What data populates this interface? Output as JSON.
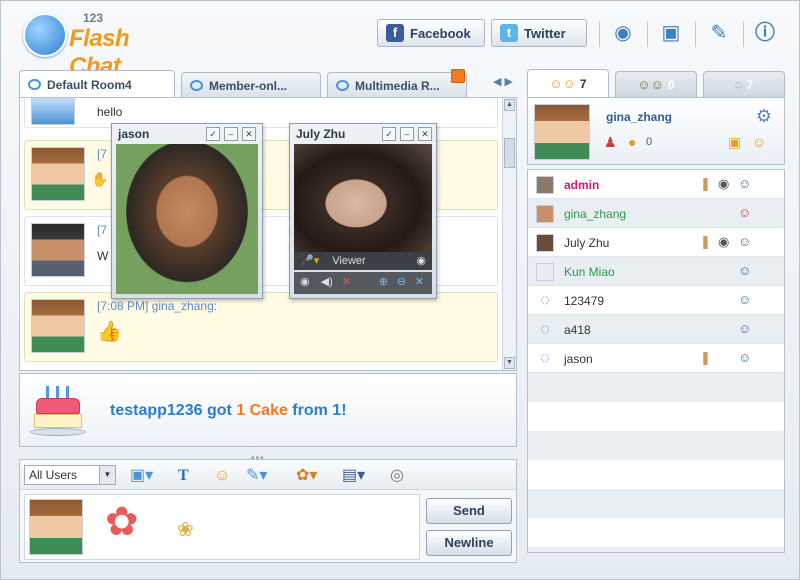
{
  "app": {
    "logo_number": "123",
    "logo_text": "Flash Chat"
  },
  "header": {
    "facebook_label": "Facebook",
    "twitter_label": "Twitter",
    "icons": [
      "webcam-icon",
      "gift-icon",
      "wrench-icon",
      "info-icon"
    ]
  },
  "room_tabs": [
    {
      "label": "Default Room4",
      "active": true
    },
    {
      "label": "Member-onl..."
    },
    {
      "label": "Multimedia R..."
    }
  ],
  "messages": [
    {
      "text": "hello",
      "type": "plain"
    },
    {
      "head": "[7",
      "type": "gina"
    },
    {
      "head": "[7",
      "text": "W",
      "type": "man"
    },
    {
      "head": "[7:08 PM] gina_zhang:",
      "type": "gina"
    }
  ],
  "video_windows": [
    {
      "title": "jason"
    },
    {
      "title": "July Zhu",
      "viewer_label": "Viewer"
    }
  ],
  "gift": {
    "prefix": "testapp1236 got ",
    "highlight": "1 Cake",
    "suffix": " from 1!"
  },
  "input": {
    "user_select": "All Users",
    "send_label": "Send",
    "newline_label": "Newline"
  },
  "right_tabs": [
    {
      "count": "7",
      "icon": "users-icon",
      "active": true
    },
    {
      "count": "0",
      "icon": "group-icon"
    },
    {
      "count": "7",
      "icon": "bubble-icon"
    }
  ],
  "profile": {
    "name": "gina_zhang",
    "coins": "0"
  },
  "users": [
    {
      "name": "admin",
      "style": "admin"
    },
    {
      "name": "gina_zhang",
      "style": "green"
    },
    {
      "name": "July Zhu",
      "style": "normal"
    },
    {
      "name": "Kun Miao",
      "style": "green"
    },
    {
      "name": "123479",
      "style": "normal"
    },
    {
      "name": "a418",
      "style": "normal"
    },
    {
      "name": "jason",
      "style": "normal"
    }
  ]
}
